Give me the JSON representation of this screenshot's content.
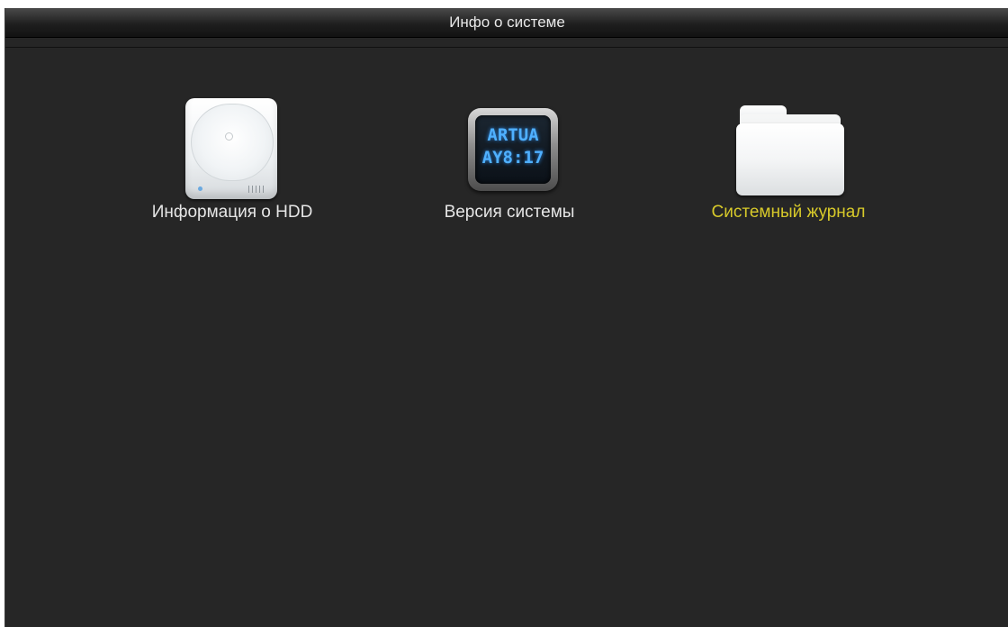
{
  "window": {
    "title": "Инфо о системе"
  },
  "tiles": [
    {
      "label": "Информация о HDD",
      "icon": "hard-drive-icon",
      "active": false
    },
    {
      "label": "Версия системы",
      "icon": "lcd-display-icon",
      "active": false,
      "display_lines": [
        "ARTUA",
        "AY8:17"
      ]
    },
    {
      "label": "Системный журнал",
      "icon": "folder-icon",
      "active": true
    }
  ],
  "colors": {
    "background": "#262626",
    "label": "#e6e6e6",
    "active_label": "#d7c92a",
    "lcd_text": "#4fb0ff"
  }
}
